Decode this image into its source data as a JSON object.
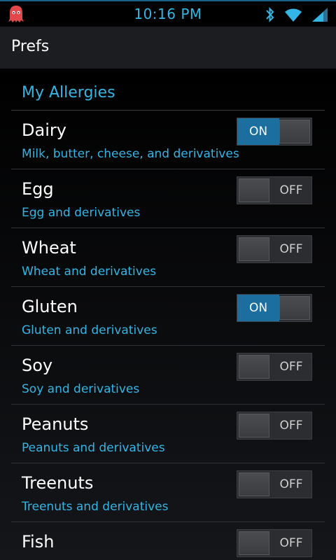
{
  "status_bar": {
    "time": "10:16 PM",
    "icons": [
      "app-ghost-icon",
      "bluetooth-icon",
      "wifi-icon",
      "signal-icon"
    ]
  },
  "action_bar": {
    "title": "Prefs"
  },
  "colors": {
    "accent": "#33b5e5",
    "switch_on": "#1c6e9e"
  },
  "category": {
    "title": "My Allergies"
  },
  "prefs": [
    {
      "title": "Dairy",
      "summary": "Milk, butter, cheese, and derivatives",
      "state": "ON",
      "on": true
    },
    {
      "title": "Egg",
      "summary": "Egg and derivatives",
      "state": "OFF",
      "on": false
    },
    {
      "title": "Wheat",
      "summary": "Wheat and derivatives",
      "state": "OFF",
      "on": false
    },
    {
      "title": "Gluten",
      "summary": "Gluten and derivatives",
      "state": "ON",
      "on": true
    },
    {
      "title": "Soy",
      "summary": "Soy and derivatives",
      "state": "OFF",
      "on": false
    },
    {
      "title": "Peanuts",
      "summary": "Peanuts and derivatives",
      "state": "OFF",
      "on": false
    },
    {
      "title": "Treenuts",
      "summary": "Treenuts and derivatives",
      "state": "OFF",
      "on": false
    },
    {
      "title": "Fish",
      "summary": "",
      "state": "OFF",
      "on": false
    }
  ]
}
